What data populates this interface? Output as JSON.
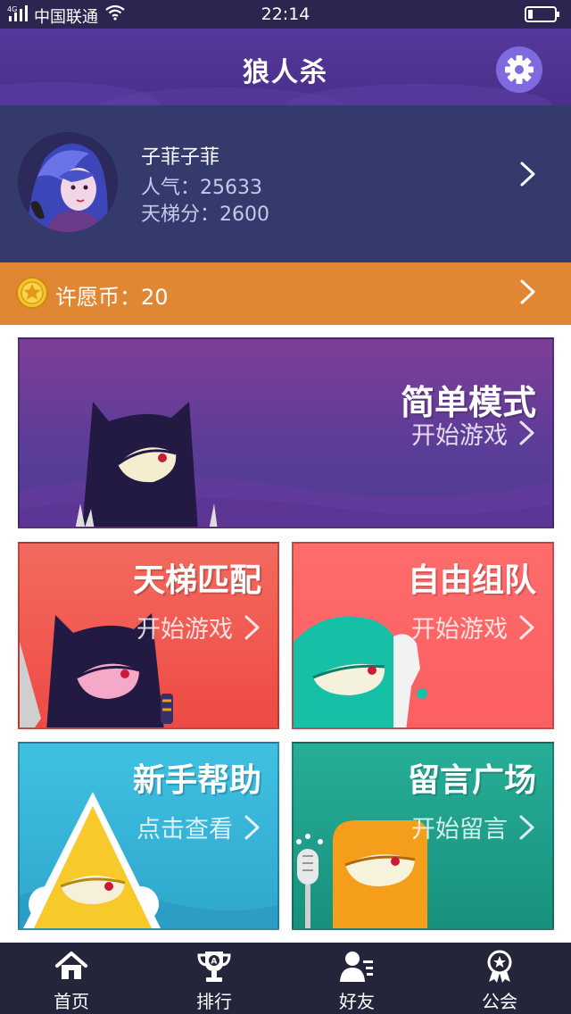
{
  "status": {
    "carrier": "中国联通",
    "time": "22:14"
  },
  "nav": {
    "title": "狼人杀"
  },
  "profile": {
    "name": "子菲子菲",
    "popularity": "人气：25633",
    "ladder_score": "天梯分：2600"
  },
  "coin": {
    "label": "许愿币：20"
  },
  "cards": {
    "simple": {
      "title": "简单模式",
      "action": "开始游戏"
    },
    "ladder": {
      "title": "天梯匹配",
      "action": "开始游戏"
    },
    "team": {
      "title": "自由组队",
      "action": "开始游戏"
    },
    "help": {
      "title": "新手帮助",
      "action": "点击查看"
    },
    "plaza": {
      "title": "留言广场",
      "action": "开始留言"
    }
  },
  "tabs": [
    {
      "label": "首页",
      "icon": "home-icon"
    },
    {
      "label": "排行",
      "icon": "trophy-icon"
    },
    {
      "label": "好友",
      "icon": "friends-icon"
    },
    {
      "label": "公会",
      "icon": "guild-icon"
    }
  ],
  "colors": {
    "nav": "#4b2f8a",
    "profile": "#353a6c",
    "coin_bar": "#e18734",
    "tab_bar": "#24253a"
  }
}
